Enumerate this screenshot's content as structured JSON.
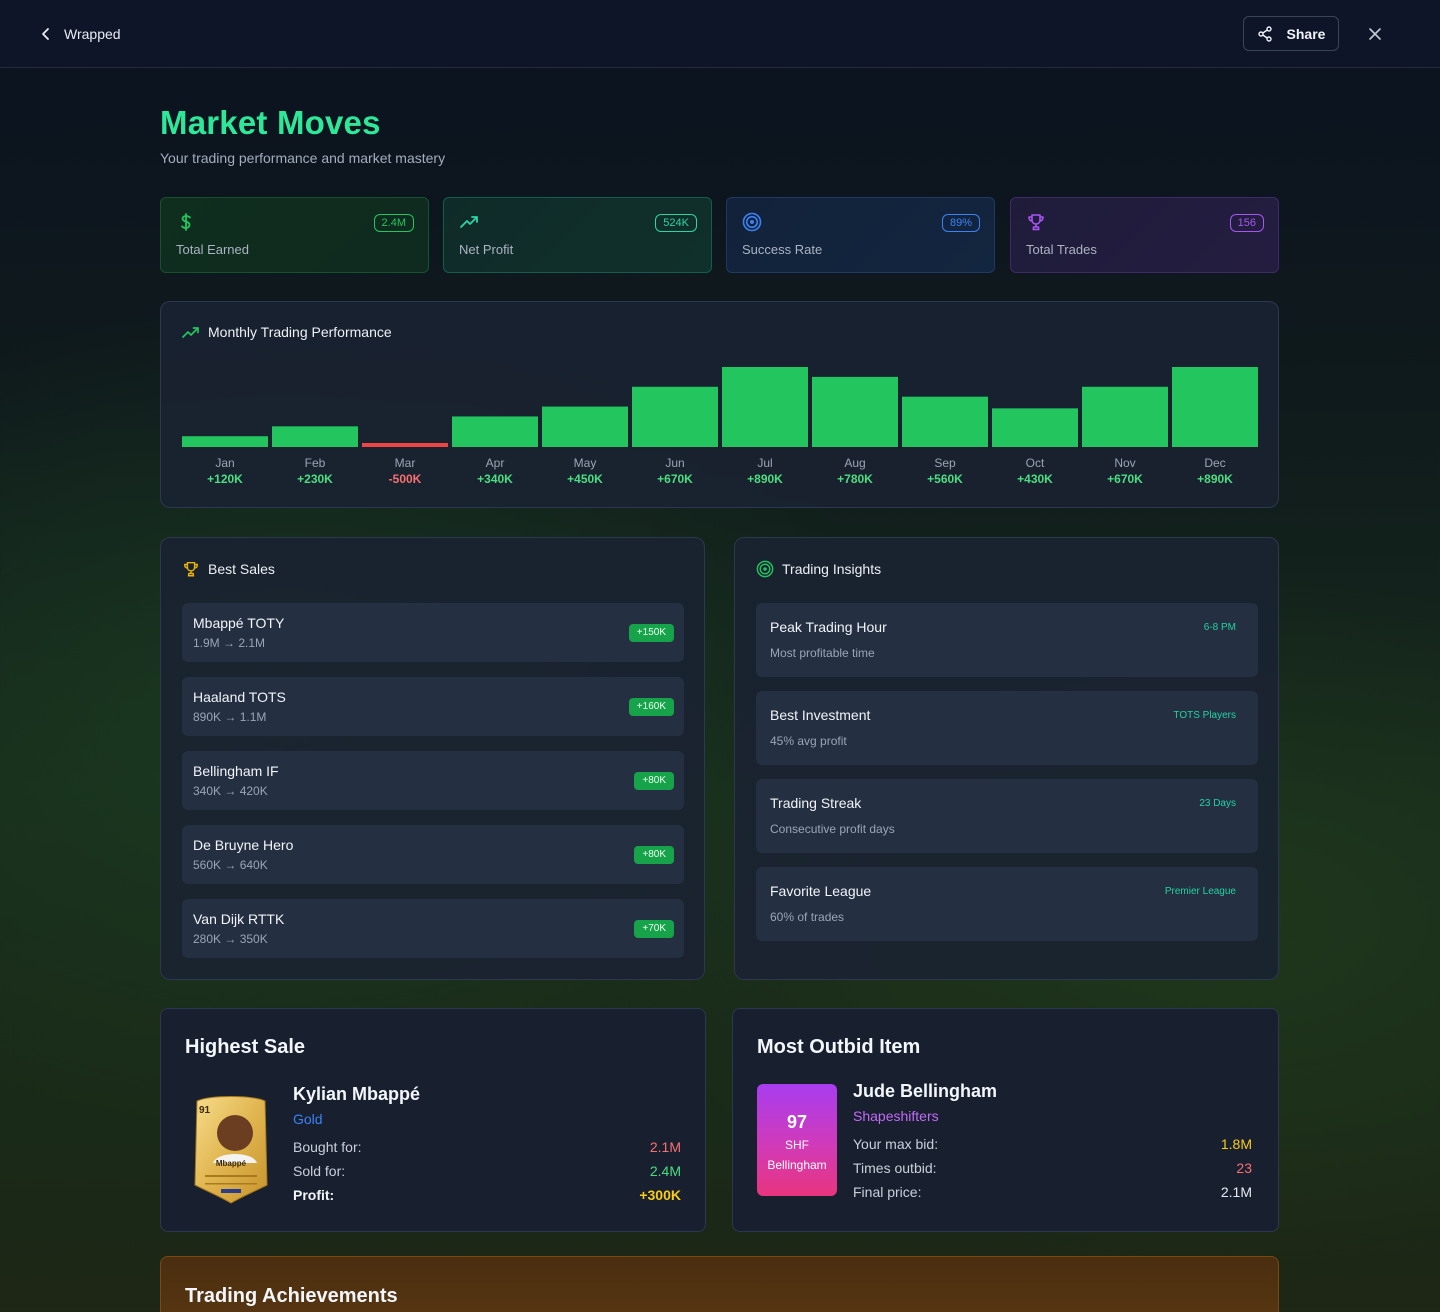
{
  "header": {
    "back_label": "Wrapped",
    "share_label": "Share"
  },
  "page": {
    "title": "Market Moves",
    "subtitle": "Your trading performance and market mastery"
  },
  "stats": [
    {
      "label": "Total Earned",
      "badge": "2.4M",
      "icon": "dollar-icon",
      "color": "#22c55e"
    },
    {
      "label": "Net Profit",
      "badge": "524K",
      "icon": "trending-up-icon",
      "color": "#2dd4a4"
    },
    {
      "label": "Success Rate",
      "badge": "89%",
      "icon": "target-icon",
      "color": "#3b82f6"
    },
    {
      "label": "Total Trades",
      "badge": "156",
      "icon": "trophy-icon",
      "color": "#a855f7"
    }
  ],
  "monthly": {
    "title": "Monthly Trading Performance",
    "icon": "trending-up-icon"
  },
  "chart_data": {
    "type": "bar",
    "categories": [
      "Jan",
      "Feb",
      "Mar",
      "Apr",
      "May",
      "Jun",
      "Jul",
      "Aug",
      "Sep",
      "Oct",
      "Nov",
      "Dec"
    ],
    "values": [
      120,
      230,
      -500,
      340,
      450,
      670,
      890,
      780,
      560,
      430,
      670,
      890
    ],
    "value_labels": [
      "+120K",
      "+230K",
      "-500K",
      "+340K",
      "+450K",
      "+670K",
      "+890K",
      "+780K",
      "+560K",
      "+430K",
      "+670K",
      "+890K"
    ],
    "title": "Monthly Trading Performance",
    "positive_color": "#22c55e",
    "negative_color": "#ef4444"
  },
  "best_sales": {
    "title": "Best Sales",
    "items": [
      {
        "name": "Mbappé TOTY",
        "range": "1.9M → 2.1M",
        "profit": "+150K"
      },
      {
        "name": "Haaland TOTS",
        "range": "890K → 1.1M",
        "profit": "+160K"
      },
      {
        "name": "Bellingham IF",
        "range": "340K → 420K",
        "profit": "+80K"
      },
      {
        "name": "De Bruyne Hero",
        "range": "560K → 640K",
        "profit": "+80K"
      },
      {
        "name": "Van Dijk RTTK",
        "range": "280K → 350K",
        "profit": "+70K"
      }
    ]
  },
  "insights": {
    "title": "Trading Insights",
    "items": [
      {
        "title": "Peak Trading Hour",
        "sub": "Most profitable time",
        "value": "6-8 PM"
      },
      {
        "title": "Best Investment",
        "sub": "45% avg profit",
        "value": "TOTS Players"
      },
      {
        "title": "Trading Streak",
        "sub": "Consecutive profit days",
        "value": "23 Days"
      },
      {
        "title": "Favorite League",
        "sub": "60% of trades",
        "value": "Premier League"
      }
    ]
  },
  "highest_sale": {
    "title": "Highest Sale",
    "player": "Kylian Mbappé",
    "type": "Gold",
    "card_rating": "91",
    "card_name": "Mbappé",
    "bought_label": "Bought for:",
    "bought": "2.1M",
    "sold_label": "Sold for:",
    "sold": "2.4M",
    "profit_label": "Profit:",
    "profit": "+300K"
  },
  "most_outbid": {
    "title": "Most Outbid Item",
    "player": "Jude Bellingham",
    "type": "Shapeshifters",
    "card_rating": "97",
    "card_code": "SHF",
    "card_name": "Bellingham",
    "max_bid_label": "Your max bid:",
    "max_bid": "1.8M",
    "outbid_label": "Times outbid:",
    "outbid": "23",
    "final_label": "Final price:",
    "final": "2.1M"
  },
  "achievements": {
    "title": "Trading Achievements"
  }
}
